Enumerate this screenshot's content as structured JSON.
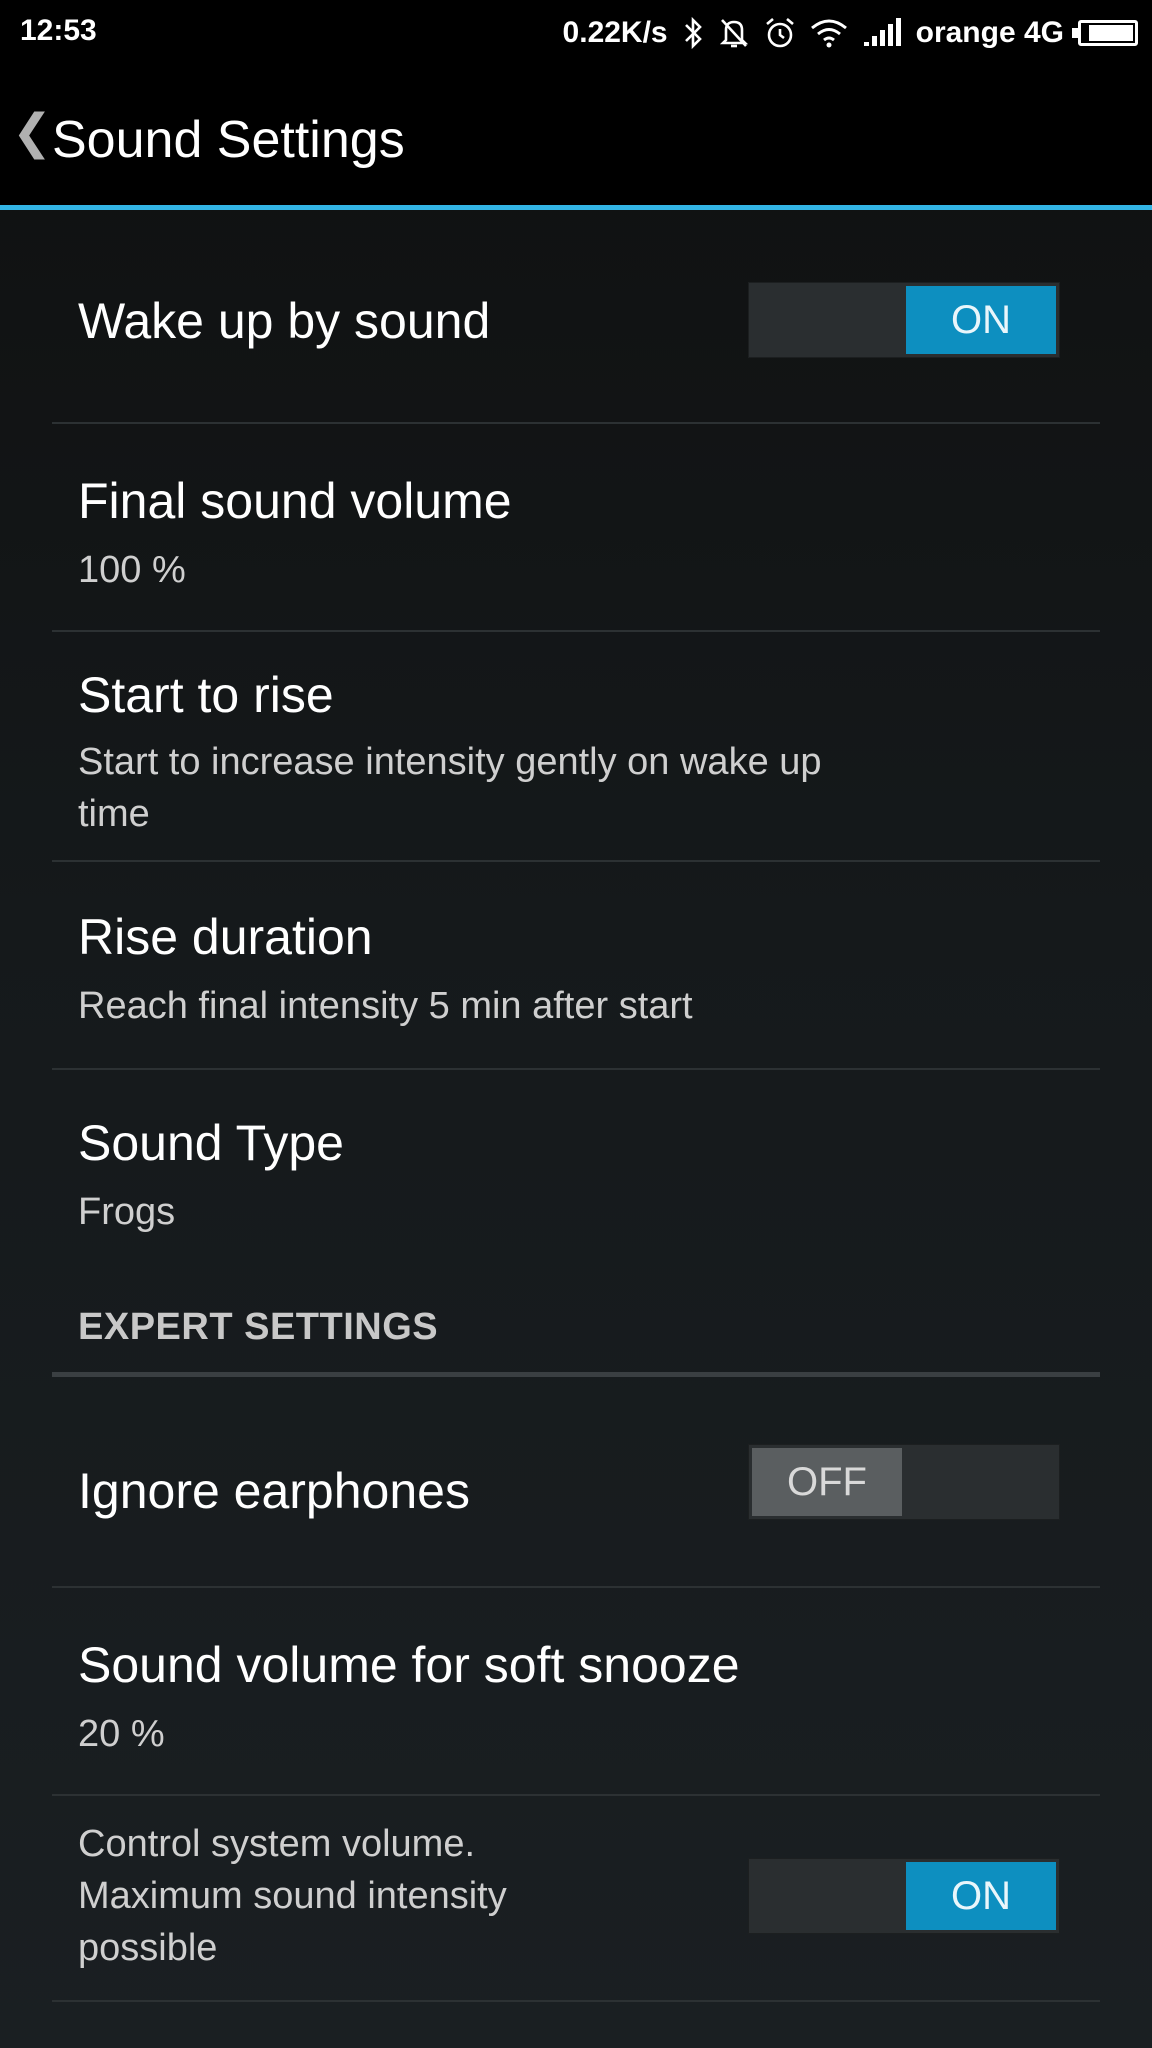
{
  "status_bar": {
    "time": "12:53",
    "net_speed": "0.22K/s",
    "carrier": "orange 4G",
    "icons": [
      "bluetooth-icon",
      "mute-icon",
      "alarm-icon",
      "wifi-icon",
      "signal-icon",
      "battery-icon"
    ]
  },
  "header": {
    "back_glyph": "❮",
    "title": "Sound Settings"
  },
  "accent_color": "#33b5e5",
  "toggle_on_color": "#0d8fc0",
  "settings": {
    "wake_up": {
      "title": "Wake up by sound",
      "toggle": "ON"
    },
    "final_volume": {
      "title": "Final sound volume",
      "summary": "100 %"
    },
    "start_rise": {
      "title": "Start to rise",
      "summary_line1": "Start to increase intensity gently on wake up",
      "summary_line2": "time"
    },
    "rise_duration": {
      "title": "Rise duration",
      "summary": "Reach final intensity 5 min after start"
    },
    "sound_type": {
      "title": "Sound Type",
      "summary": "Frogs"
    }
  },
  "expert": {
    "header": "EXPERT SETTINGS",
    "ignore_earphones": {
      "title": "Ignore earphones",
      "toggle": "OFF"
    },
    "soft_snooze": {
      "title": "Sound volume for soft snooze",
      "summary": "20 %"
    },
    "control_volume": {
      "line1": "Control system volume.",
      "line2": "Maximum sound intensity",
      "line3": "possible",
      "toggle": "ON"
    }
  }
}
